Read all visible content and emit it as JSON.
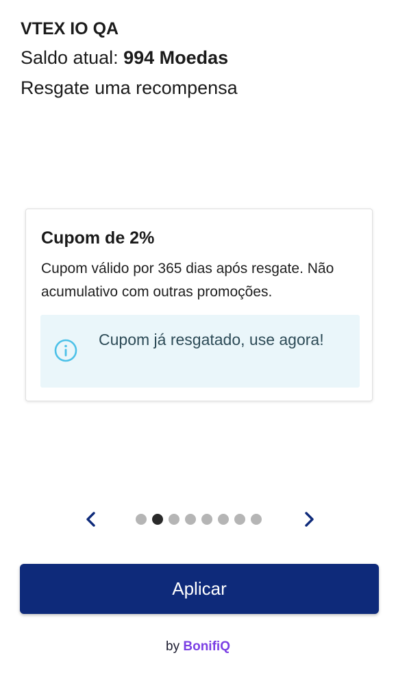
{
  "header": {
    "store_name": "VTEX IO QA",
    "balance_label": "Saldo atual:",
    "balance_value": "994 Moedas",
    "subtitle": "Resgate uma recompensa"
  },
  "card": {
    "title": "Cupom de 2%",
    "description": "Cupom válido por 365 dias após resgate. Não acumulativo com outras promoções.",
    "notice": {
      "icon": "info-icon",
      "text": "Cupom já resgatado, use agora!"
    }
  },
  "pager": {
    "prev_icon": "chevron-left-icon",
    "next_icon": "chevron-right-icon",
    "total": 8,
    "current": 2
  },
  "apply_button": {
    "label": "Aplicar"
  },
  "footer": {
    "by": "by",
    "brand": "BonifiQ"
  },
  "colors": {
    "primary": "#0e2a7a",
    "brand": "#7b3fe4",
    "notice_bg": "#eaf6fa",
    "info_icon": "#4cc1e8"
  }
}
